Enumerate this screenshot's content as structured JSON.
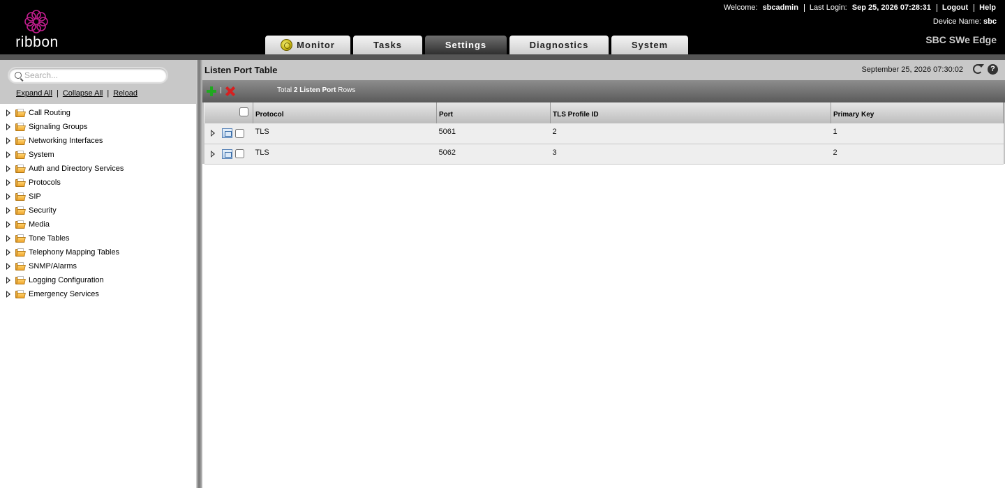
{
  "brand": {
    "logo_text": "ribbon",
    "accent_color": "#c11d8d"
  },
  "header": {
    "welcome_label": "Welcome:",
    "username": "sbcadmin",
    "last_login_label": "Last Login:",
    "last_login": "Sep 25, 2026 07:28:31",
    "logout_label": "Logout",
    "help_label": "Help",
    "device_name_label": "Device Name:",
    "device_name": "sbc",
    "product": "SBC SWe Edge"
  },
  "tabs": [
    {
      "label": "Monitor",
      "active": false,
      "icon": "monitor-icon"
    },
    {
      "label": "Tasks",
      "active": false
    },
    {
      "label": "Settings",
      "active": true
    },
    {
      "label": "Diagnostics",
      "active": false
    },
    {
      "label": "System",
      "active": false
    }
  ],
  "sidebar": {
    "search_placeholder": "Search...",
    "expand_all": "Expand All",
    "collapse_all": "Collapse All",
    "reload": "Reload",
    "items": [
      {
        "label": "Call Routing"
      },
      {
        "label": "Signaling Groups"
      },
      {
        "label": "Networking Interfaces"
      },
      {
        "label": "System"
      },
      {
        "label": "Auth and Directory Services"
      },
      {
        "label": "Protocols"
      },
      {
        "label": "SIP"
      },
      {
        "label": "Security"
      },
      {
        "label": "Media"
      },
      {
        "label": "Tone Tables"
      },
      {
        "label": "Telephony Mapping Tables"
      },
      {
        "label": "SNMP/Alarms"
      },
      {
        "label": "Logging Configuration"
      },
      {
        "label": "Emergency Services"
      }
    ]
  },
  "main": {
    "title": "Listen Port Table",
    "timestamp": "September 25, 2026 07:30:02",
    "help_glyph": "?",
    "summary_prefix": "Total",
    "summary_bold": "2 Listen Port",
    "summary_suffix": "Rows",
    "table": {
      "columns": [
        "Protocol",
        "Port",
        "TLS Profile ID",
        "Primary Key"
      ],
      "rows": [
        {
          "protocol": "TLS",
          "port": "5061",
          "tls_profile_id": "2",
          "primary_key": "1"
        },
        {
          "protocol": "TLS",
          "port": "5062",
          "tls_profile_id": "3",
          "primary_key": "2"
        }
      ]
    }
  }
}
